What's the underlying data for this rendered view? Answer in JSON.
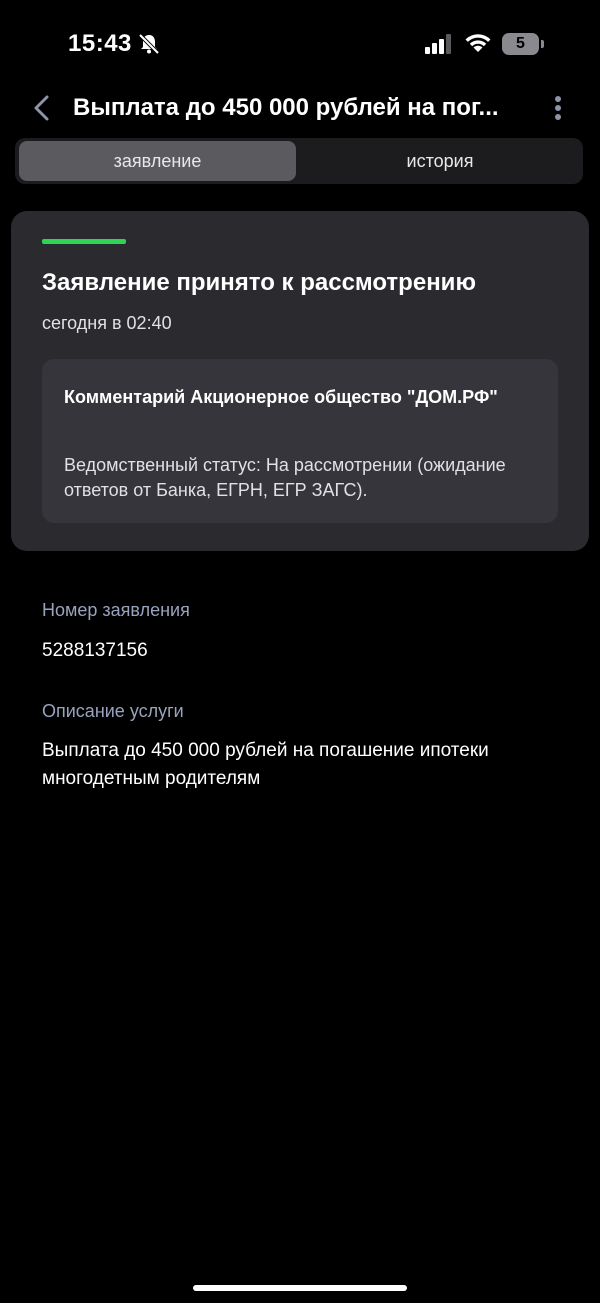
{
  "status_bar": {
    "time": "15:43",
    "battery_level": "5",
    "icons": [
      "bell-slash-icon",
      "cellular-signal-icon",
      "wifi-icon",
      "battery-icon"
    ]
  },
  "header": {
    "title": "Выплата до 450 000 рублей на пог...",
    "icons": [
      "chevron-left-icon",
      "more-vertical-icon"
    ]
  },
  "tabs": [
    {
      "label": "заявление",
      "active": true
    },
    {
      "label": "история",
      "active": false
    }
  ],
  "status_card": {
    "progress_color": "#2fd356",
    "title": "Заявление принято к рассмотрению",
    "date": "сегодня в 02:40",
    "comment": {
      "title": "Комментарий Акционерное общество \"ДОМ.РФ\"",
      "text": "Ведомственный статус: На рассмотрении (ожидание ответов от Банка, ЕГРН, ЕГР ЗАГС)."
    }
  },
  "fields": {
    "application_number": {
      "label": "Номер заявления",
      "value": "5288137156"
    },
    "service_description": {
      "label": "Описание услуги",
      "value": "Выплата до 450 000 рублей на погашение ипотеки многодетным родителям"
    }
  },
  "colors": {
    "background": "#000000",
    "card": "#2a2a2f",
    "accent_green": "#2fd356",
    "label": "#9aa3bd"
  }
}
